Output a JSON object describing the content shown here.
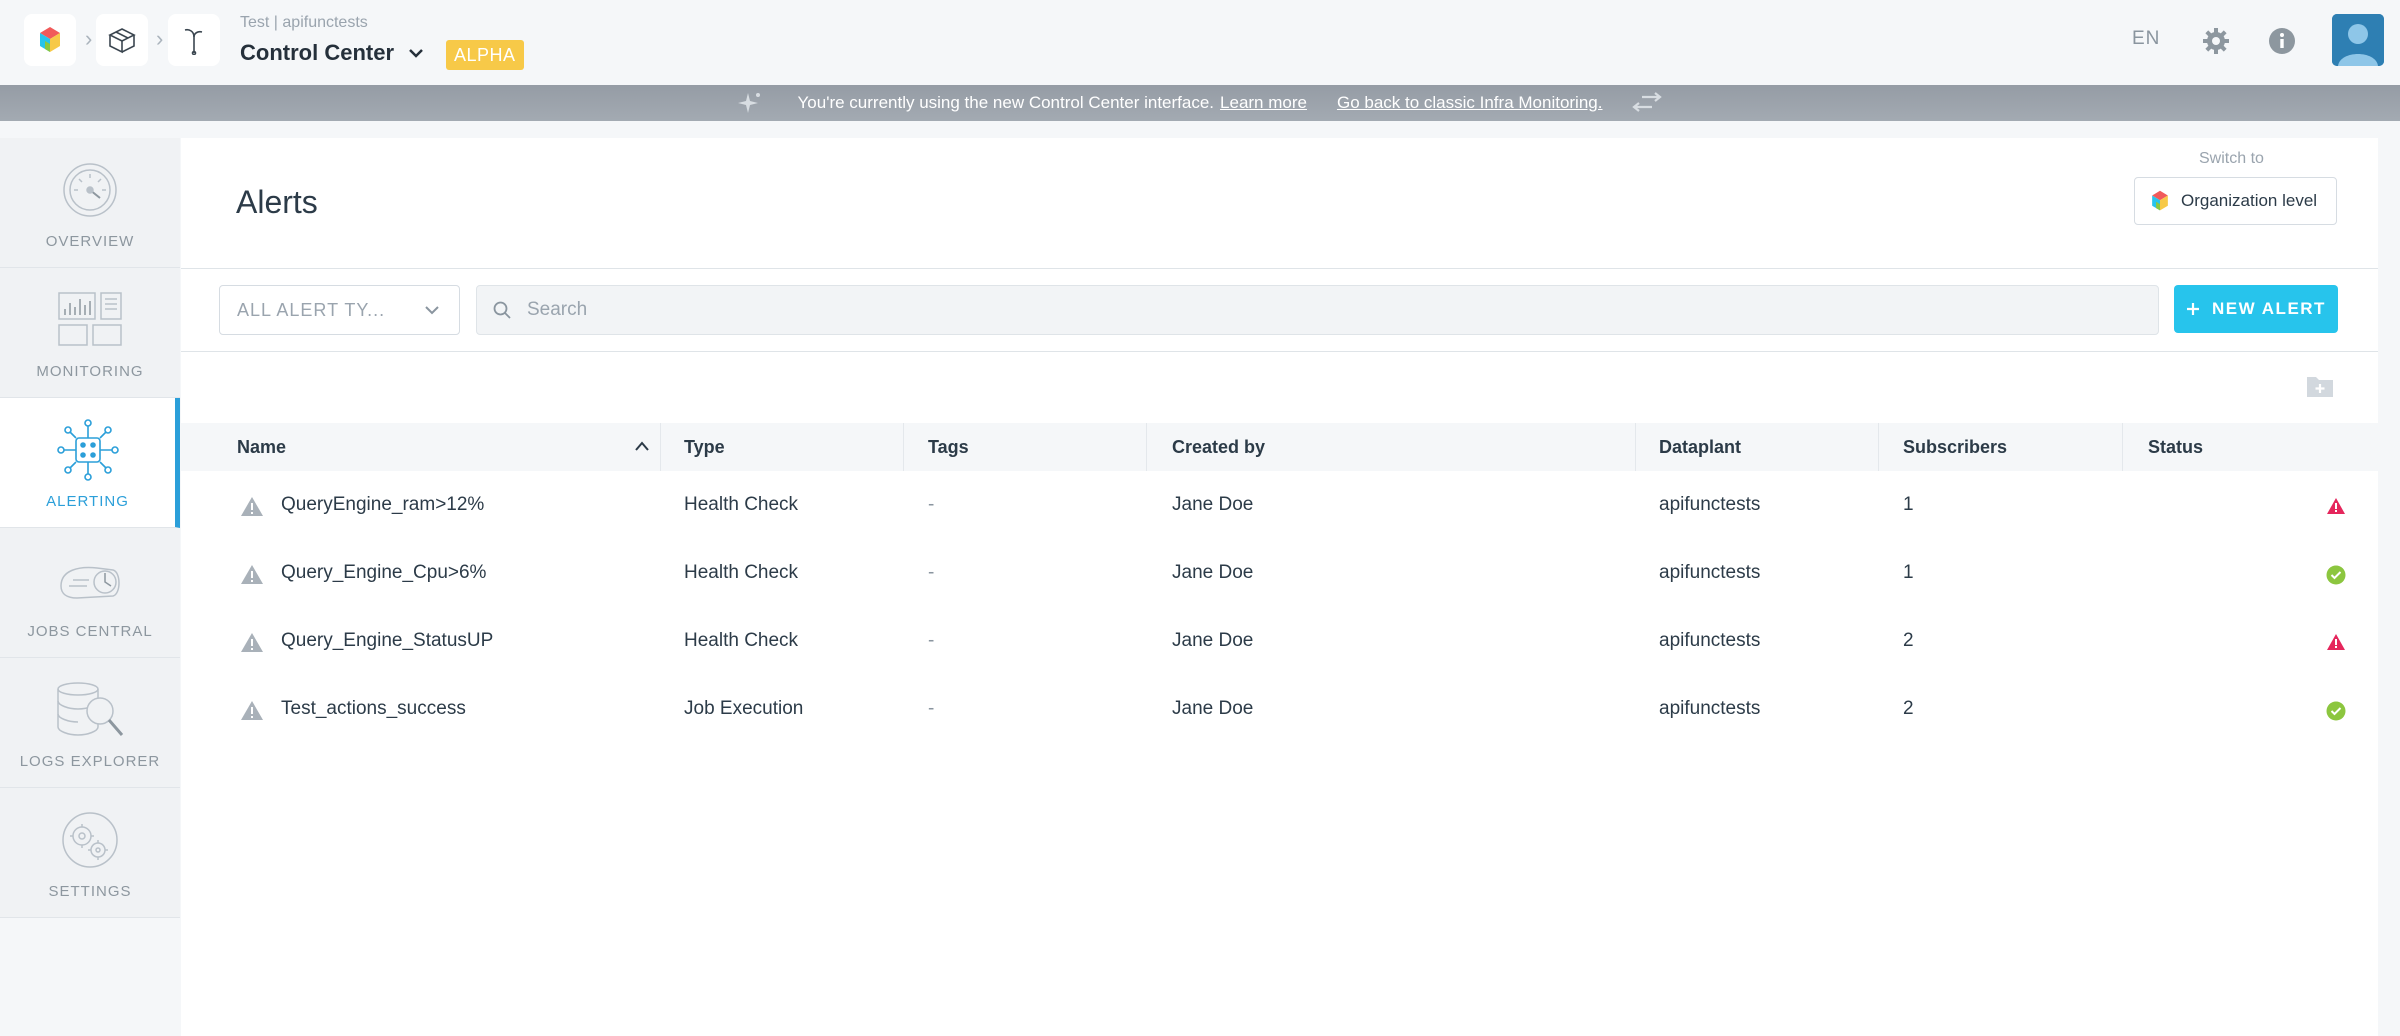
{
  "header": {
    "environment": "Test | apifunctests",
    "app_title": "Control Center",
    "badge": "ALPHA",
    "language": "EN"
  },
  "banner": {
    "message": "You're currently using the new Control Center interface.",
    "learn_more": "Learn more",
    "back_link": "Go back to classic Infra Monitoring."
  },
  "sidebar": {
    "items": [
      {
        "label": "OVERVIEW",
        "icon": "gauge-icon",
        "active": false
      },
      {
        "label": "MONITORING",
        "icon": "dashboard-icon",
        "active": false
      },
      {
        "label": "ALERTING",
        "icon": "alert-network-icon",
        "active": true
      },
      {
        "label": "JOBS CENTRAL",
        "icon": "jobs-icon",
        "active": false
      },
      {
        "label": "LOGS EXPLORER",
        "icon": "logs-search-icon",
        "active": false
      },
      {
        "label": "SETTINGS",
        "icon": "gears-icon",
        "active": false
      }
    ]
  },
  "main": {
    "title": "Alerts",
    "switch_label": "Switch to",
    "org_button": "Organization level",
    "filter_value": "ALL ALERT TY...",
    "search_placeholder": "Search",
    "new_alert_label": "NEW ALERT"
  },
  "table": {
    "columns": [
      "Name",
      "Type",
      "Tags",
      "Created by",
      "Dataplant",
      "Subscribers",
      "Status"
    ],
    "sorted_column": "Name",
    "rows": [
      {
        "name": "QueryEngine_ram>12%",
        "type": "Health Check",
        "tags": "-",
        "created_by": "Jane Doe",
        "dataplant": "apifunctests",
        "subscribers": "1",
        "status": "alert"
      },
      {
        "name": "Query_Engine_Cpu>6%",
        "type": "Health Check",
        "tags": "-",
        "created_by": "Jane Doe",
        "dataplant": "apifunctests",
        "subscribers": "1",
        "status": "ok"
      },
      {
        "name": "Query_Engine_StatusUP",
        "type": "Health Check",
        "tags": "-",
        "created_by": "Jane Doe",
        "dataplant": "apifunctests",
        "subscribers": "2",
        "status": "alert"
      },
      {
        "name": "Test_actions_success",
        "type": "Job Execution",
        "tags": "-",
        "created_by": "Jane Doe",
        "dataplant": "apifunctests",
        "subscribers": "2",
        "status": "ok"
      }
    ]
  },
  "colors": {
    "accent": "#2b9fd9",
    "new_alert": "#27c4ec",
    "badge": "#f7c948",
    "status_alert": "#e5265c",
    "status_ok": "#8cc63f"
  }
}
